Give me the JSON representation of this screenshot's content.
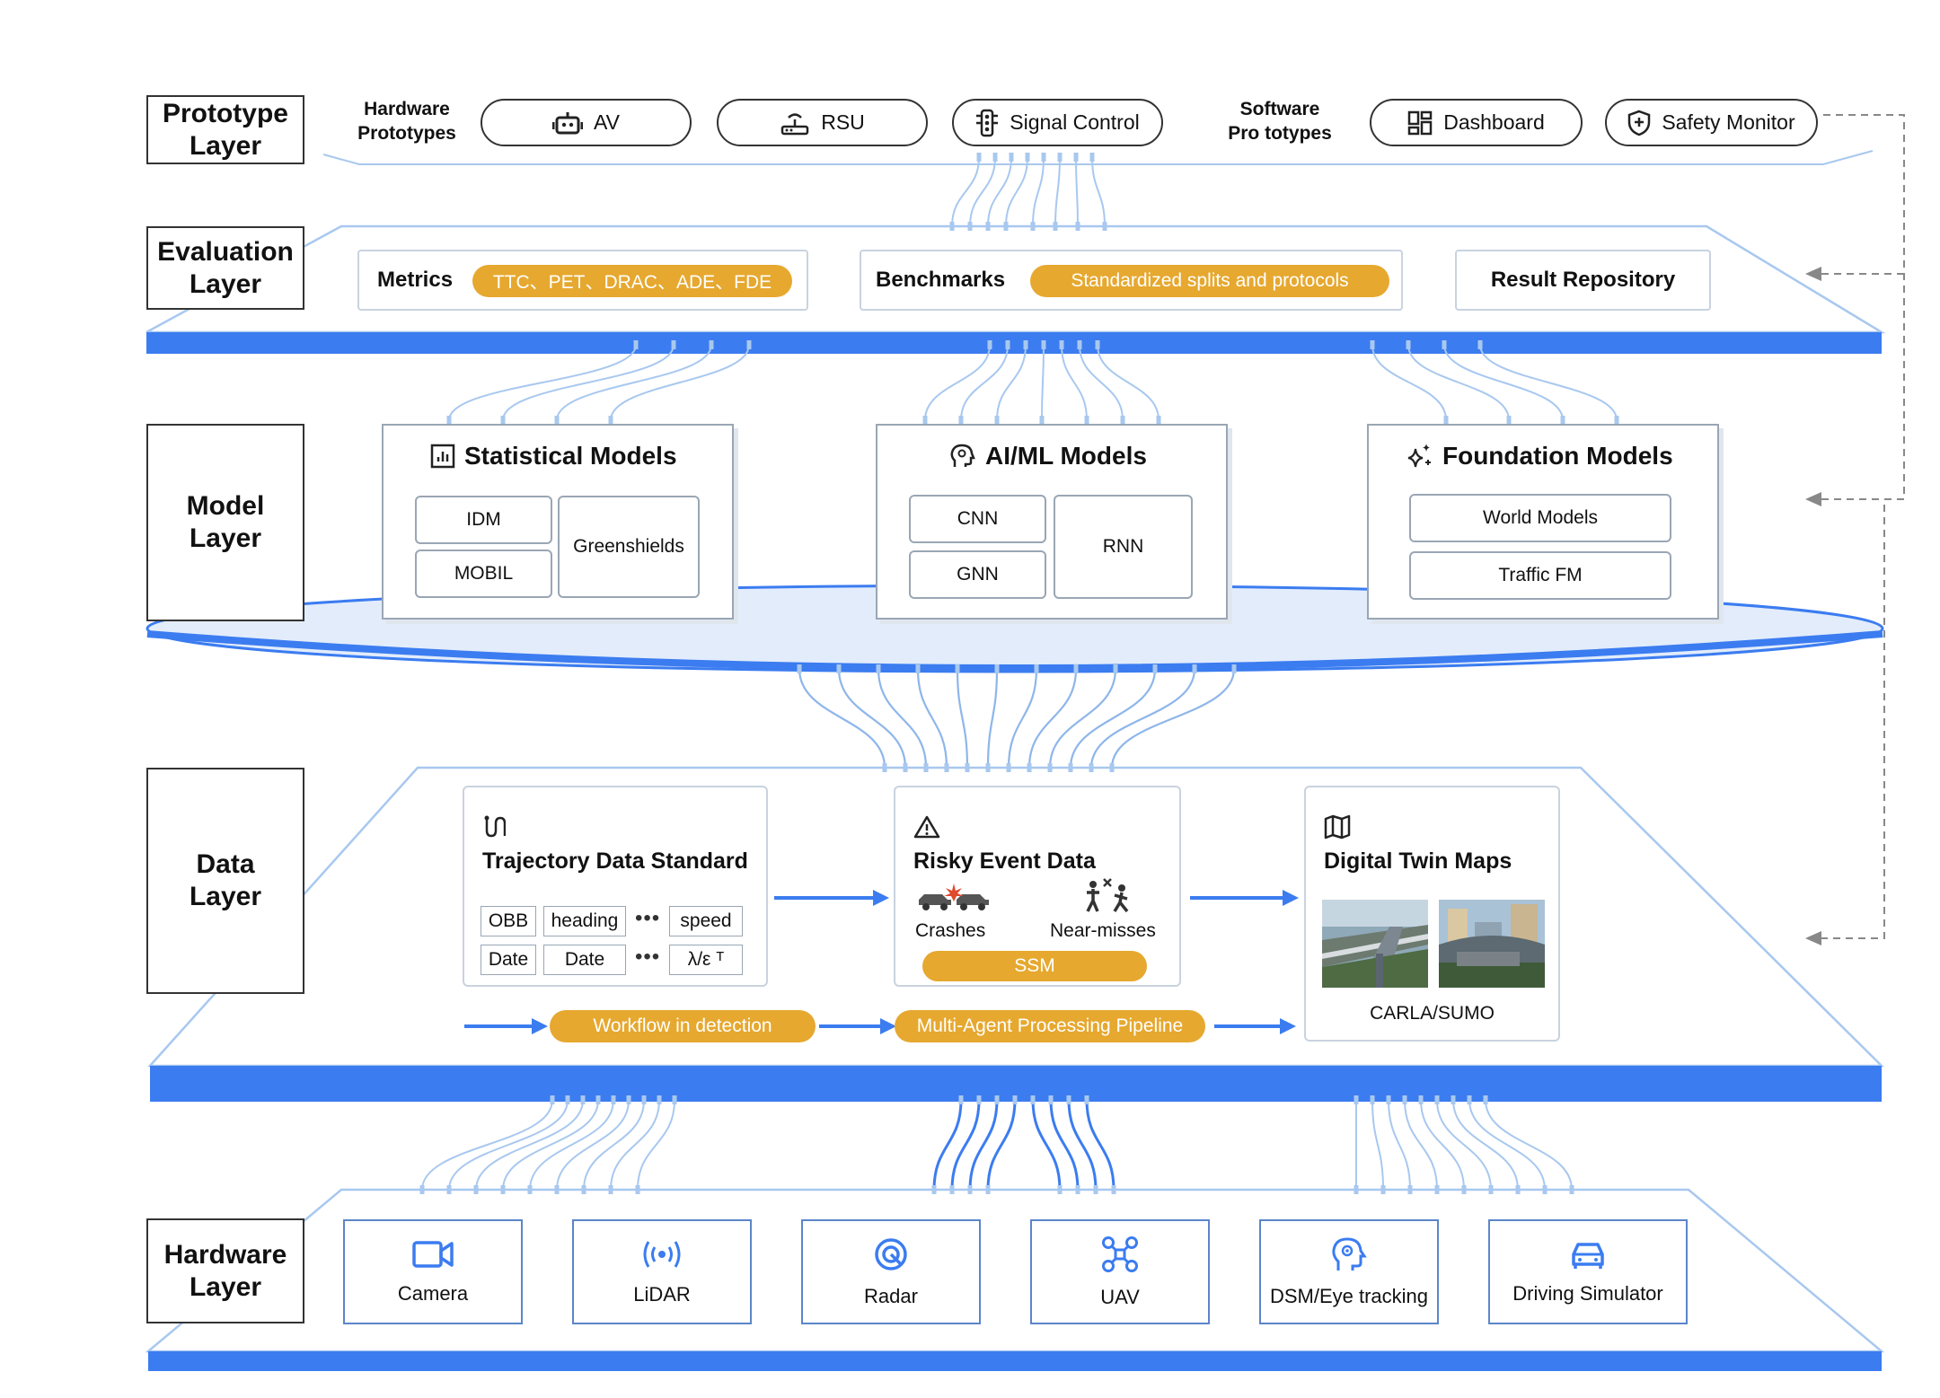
{
  "colors": {
    "accent_blue": "#3b7cf0",
    "line_blue": "#a8c8ef",
    "orange": "#e6a82f",
    "border_dark": "#333333"
  },
  "prototype_layer": {
    "label_line1": "Prototype",
    "label_line2": "Layer",
    "hardware_title_line1": "Hardware",
    "hardware_title_line2": "Prototypes",
    "hardware_items": [
      {
        "label": "AV",
        "icon": "robot-icon"
      },
      {
        "label": "RSU",
        "icon": "router-icon"
      },
      {
        "label": "Signal Control",
        "icon": "traffic-light-icon"
      }
    ],
    "software_title_line1": "Software",
    "software_title_line2": "Pro totypes",
    "software_items": [
      {
        "label": "Dashboard",
        "icon": "dashboard-icon"
      },
      {
        "label": "Safety Monitor",
        "icon": "shield-icon"
      }
    ]
  },
  "evaluation_layer": {
    "label_line1": "Evaluation",
    "label_line2": "Layer",
    "metrics_label": "Metrics",
    "metrics_value": "TTC、PET、DRAC、ADE、FDE",
    "benchmarks_label": "Benchmarks",
    "benchmarks_value": "Standardized splits and protocols",
    "repository_label": "Result Repository"
  },
  "model_layer": {
    "label_line1": "Model",
    "label_line2": "Layer",
    "statistical": {
      "title": "Statistical Models",
      "icon": "bar-chart-icon",
      "items": [
        "IDM",
        "MOBIL",
        "Greenshields"
      ]
    },
    "aiml": {
      "title": "AI/ML Models",
      "icon": "brain-head-icon",
      "items": [
        "CNN",
        "GNN",
        "RNN"
      ]
    },
    "foundation": {
      "title": "Foundation Models",
      "icon": "sparkles-icon",
      "items": [
        "World Models",
        "Traffic FM"
      ]
    }
  },
  "data_layer": {
    "label_line1": "Data",
    "label_line2": "Layer",
    "trajectory": {
      "title": "Trajectory Data Standard",
      "icon": "route-icon",
      "row1": [
        "OBB",
        "heading",
        "speed"
      ],
      "row2": [
        "Date",
        "Date",
        "λ/ε ᵀ"
      ],
      "ellipsis": "•••"
    },
    "risky": {
      "title": "Risky Event Data",
      "icon": "warning-icon",
      "crashes": "Crashes",
      "near_misses": "Near-misses",
      "ssm": "SSM"
    },
    "twin": {
      "title": "Digital Twin Maps",
      "icon": "map-icon",
      "caption": "CARLA/SUMO"
    },
    "workflow_label": "Workflow in detection",
    "pipeline_label": "Multi-Agent Processing Pipeline"
  },
  "hardware_layer": {
    "label_line1": "Hardware",
    "label_line2": "Layer",
    "items": [
      {
        "label": "Camera",
        "icon": "camera-icon"
      },
      {
        "label": "LiDAR",
        "icon": "lidar-icon"
      },
      {
        "label": "Radar",
        "icon": "radar-icon"
      },
      {
        "label": "UAV",
        "icon": "drone-icon"
      },
      {
        "label": "DSM/Eye tracking",
        "icon": "eye-tracking-icon"
      },
      {
        "label": "Driving Simulator",
        "icon": "car-icon"
      }
    ]
  }
}
